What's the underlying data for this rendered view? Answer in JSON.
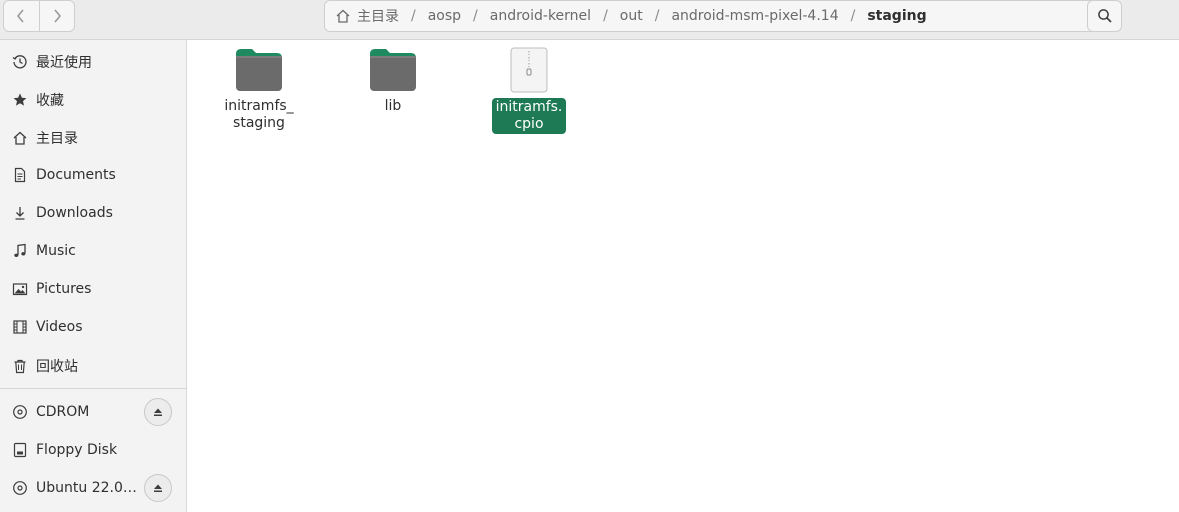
{
  "nav": {
    "back_icon": "chevron-left-icon",
    "forward_icon": "chevron-right-icon"
  },
  "pathbar": {
    "home_icon": "home-icon",
    "crumbs": [
      "主目录",
      "aosp",
      "android-kernel",
      "out",
      "android-msm-pixel-4.14",
      "staging"
    ],
    "separator": "/",
    "menu_glyph": "⋮"
  },
  "search": {
    "icon": "search-icon"
  },
  "sidebar": {
    "places": [
      {
        "label": "最近使用",
        "icon": "clock-icon"
      },
      {
        "label": "收藏",
        "icon": "star-icon"
      },
      {
        "label": "主目录",
        "icon": "home-icon"
      },
      {
        "label": "Documents",
        "icon": "document-icon"
      },
      {
        "label": "Downloads",
        "icon": "download-icon"
      },
      {
        "label": "Music",
        "icon": "music-note-icon"
      },
      {
        "label": "Pictures",
        "icon": "picture-icon"
      },
      {
        "label": "Videos",
        "icon": "film-icon"
      },
      {
        "label": "回收站",
        "icon": "trash-icon"
      }
    ],
    "devices": [
      {
        "label": "CDROM",
        "icon": "disc-icon",
        "ejectable": true
      },
      {
        "label": "Floppy Disk",
        "icon": "drive-icon",
        "ejectable": false
      },
      {
        "label": "Ubuntu 22.0…",
        "icon": "disc-icon",
        "ejectable": true
      }
    ]
  },
  "files": [
    {
      "name_lines": [
        "initramfs_",
        "staging"
      ],
      "type": "folder",
      "selected": false
    },
    {
      "name_lines": [
        "lib"
      ],
      "type": "folder",
      "selected": false
    },
    {
      "name_lines": [
        "initramfs.",
        "cpio"
      ],
      "type": "archive",
      "selected": true
    }
  ],
  "colors": {
    "selection": "#1d7a55",
    "folder_tab": "#1f8a5f",
    "folder_body": "#6b6b6b"
  }
}
